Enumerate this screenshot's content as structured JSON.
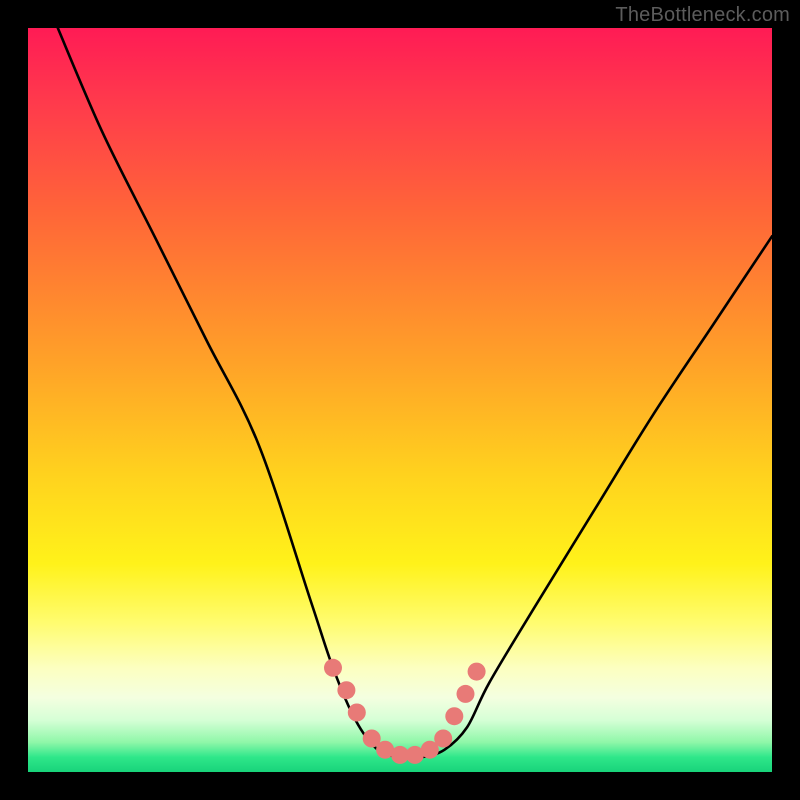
{
  "watermark": "TheBottleneck.com",
  "chart_data": {
    "type": "line",
    "title": "",
    "xlabel": "",
    "ylabel": "",
    "xlim": [
      0,
      100
    ],
    "ylim": [
      0,
      100
    ],
    "series": [
      {
        "name": "bottleneck-curve",
        "x": [
          4,
          10,
          17,
          24,
          31,
          38,
          41,
          44,
          47,
          50,
          53,
          56,
          59,
          62,
          68,
          76,
          84,
          92,
          100
        ],
        "values": [
          100,
          86,
          72,
          58,
          44,
          23,
          14,
          7,
          3,
          2,
          2,
          3,
          6,
          12,
          22,
          35,
          48,
          60,
          72
        ]
      }
    ],
    "markers": {
      "name": "bead-markers",
      "color": "#e87a77",
      "points_x": [
        41.0,
        42.8,
        44.2,
        46.2,
        48.0,
        50.0,
        52.0,
        54.0,
        55.8,
        57.3,
        58.8,
        60.3
      ],
      "points_y": [
        14.0,
        11.0,
        8.0,
        4.5,
        3.0,
        2.3,
        2.3,
        3.0,
        4.5,
        7.5,
        10.5,
        13.5
      ]
    },
    "gradient_stops": [
      {
        "pos": 0.0,
        "color": "#ff1b55"
      },
      {
        "pos": 0.45,
        "color": "#ffa228"
      },
      {
        "pos": 0.72,
        "color": "#fff21a"
      },
      {
        "pos": 0.92,
        "color": "#d6ffd6"
      },
      {
        "pos": 1.0,
        "color": "#18d37a"
      }
    ]
  }
}
